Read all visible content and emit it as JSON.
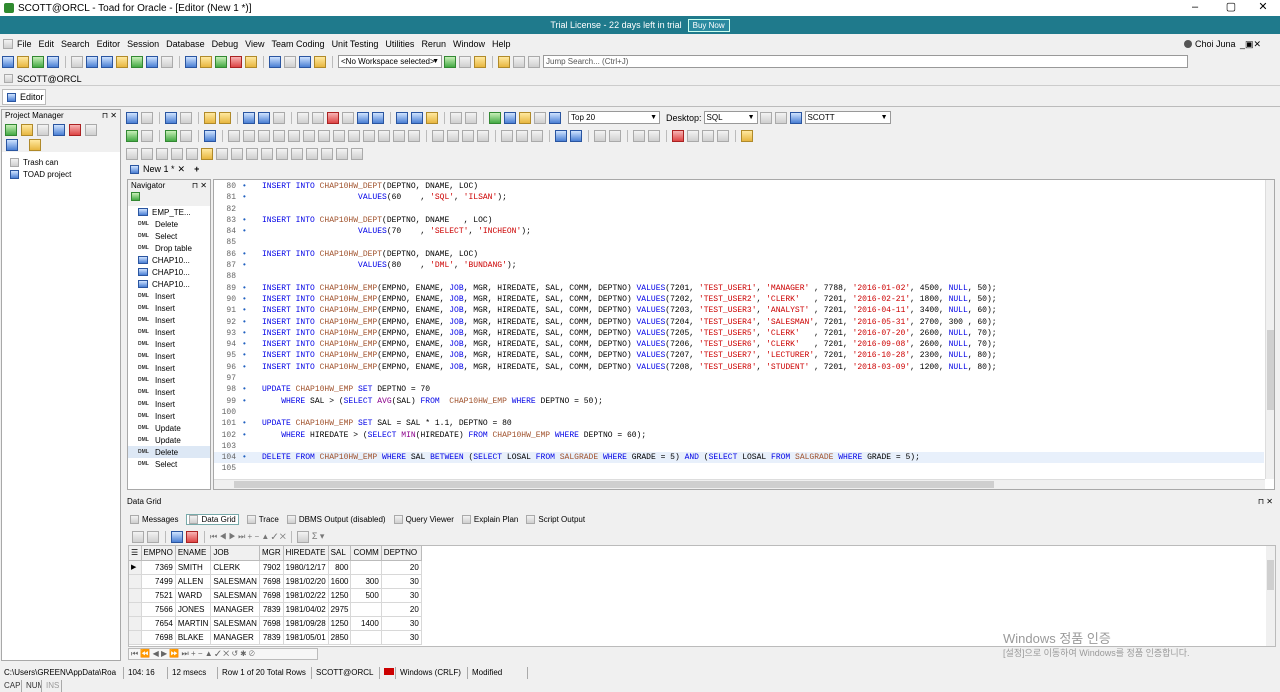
{
  "window": {
    "title": "SCOTT@ORCL - Toad for Oracle - [Editor (New 1 *)]"
  },
  "trial": {
    "text": "Trial License - 22 days left in trial",
    "buy": "Buy Now"
  },
  "menu": [
    "File",
    "Edit",
    "Search",
    "Editor",
    "Session",
    "Database",
    "Debug",
    "View",
    "Team Coding",
    "Unit Testing",
    "Utilities",
    "Rerun",
    "Window",
    "Help"
  ],
  "user": "Choi Juna",
  "workspace": "<No Workspace selected>",
  "jump_search": "Jump Search... (Ctrl+J)",
  "connection_tab": "SCOTT@ORCL",
  "editor_tab": "Editor",
  "project_manager": {
    "title": "Project Manager",
    "items": [
      "Trash can",
      "TOAD project"
    ]
  },
  "editor_toolbar": {
    "top_rows": "Top 20",
    "desktop_label": "Desktop:",
    "desktop_value": "SQL",
    "schema": "SCOTT"
  },
  "doc_tab": "New 1 *",
  "navigator": {
    "title": "Navigator",
    "items": [
      {
        "kind": "table",
        "label": "EMP_TE..."
      },
      {
        "kind": "dml",
        "label": "Delete"
      },
      {
        "kind": "dml",
        "label": "Select"
      },
      {
        "kind": "dml",
        "label": "Drop table"
      },
      {
        "kind": "table",
        "label": "CHAP10..."
      },
      {
        "kind": "table",
        "label": "CHAP10..."
      },
      {
        "kind": "table",
        "label": "CHAP10..."
      },
      {
        "kind": "dml",
        "label": "Insert"
      },
      {
        "kind": "dml",
        "label": "Insert"
      },
      {
        "kind": "dml",
        "label": "Insert"
      },
      {
        "kind": "dml",
        "label": "Insert"
      },
      {
        "kind": "dml",
        "label": "Insert"
      },
      {
        "kind": "dml",
        "label": "Insert"
      },
      {
        "kind": "dml",
        "label": "Insert"
      },
      {
        "kind": "dml",
        "label": "Insert"
      },
      {
        "kind": "dml",
        "label": "Insert"
      },
      {
        "kind": "dml",
        "label": "Insert"
      },
      {
        "kind": "dml",
        "label": "Insert"
      },
      {
        "kind": "dml",
        "label": "Update"
      },
      {
        "kind": "dml",
        "label": "Update"
      },
      {
        "kind": "dml",
        "label": "Delete"
      },
      {
        "kind": "dml",
        "label": "Select"
      }
    ]
  },
  "code_lines": [
    {
      "n": "80",
      "html": "<span class='kw'>INSERT INTO</span> <span class='tbl'>CHAP10HW_DEPT</span>(DEPTNO, DNAME, LOC)"
    },
    {
      "n": "81",
      "html": "                    <span class='kw'>VALUES</span>(60    , <span class='str'>'SQL'</span>, <span class='str'>'ILSAN'</span>);"
    },
    {
      "n": "82",
      "html": ""
    },
    {
      "n": "83",
      "html": "<span class='kw'>INSERT INTO</span> <span class='tbl'>CHAP10HW_DEPT</span>(DEPTNO, DNAME   , LOC)"
    },
    {
      "n": "84",
      "html": "                    <span class='kw'>VALUES</span>(70    , <span class='str'>'SELECT'</span>, <span class='str'>'INCHEON'</span>);"
    },
    {
      "n": "85",
      "html": ""
    },
    {
      "n": "86",
      "html": "<span class='kw'>INSERT INTO</span> <span class='tbl'>CHAP10HW_DEPT</span>(DEPTNO, DNAME, LOC)"
    },
    {
      "n": "87",
      "html": "                    <span class='kw'>VALUES</span>(80    , <span class='str'>'DML'</span>, <span class='str'>'BUNDANG'</span>);"
    },
    {
      "n": "88",
      "html": ""
    },
    {
      "n": "89",
      "html": "<span class='kw'>INSERT INTO</span> <span class='tbl'>CHAP10HW_EMP</span>(EMPNO, ENAME, <span class='kw'>JOB</span>, MGR, HIREDATE, SAL, COMM, DEPTNO) <span class='kw'>VALUES</span>(7201, <span class='str'>'TEST_USER1'</span>, <span class='str'>'MANAGER'</span> , 7788, <span class='str'>'2016-01-02'</span>, 4500, <span class='kw'>NULL</span>, 50);"
    },
    {
      "n": "90",
      "html": "<span class='kw'>INSERT INTO</span> <span class='tbl'>CHAP10HW_EMP</span>(EMPNO, ENAME, <span class='kw'>JOB</span>, MGR, HIREDATE, SAL, COMM, DEPTNO) <span class='kw'>VALUES</span>(7202, <span class='str'>'TEST_USER2'</span>, <span class='str'>'CLERK'</span>   , 7201, <span class='str'>'2016-02-21'</span>, 1800, <span class='kw'>NULL</span>, 50);"
    },
    {
      "n": "91",
      "html": "<span class='kw'>INSERT INTO</span> <span class='tbl'>CHAP10HW_EMP</span>(EMPNO, ENAME, <span class='kw'>JOB</span>, MGR, HIREDATE, SAL, COMM, DEPTNO) <span class='kw'>VALUES</span>(7203, <span class='str'>'TEST_USER3'</span>, <span class='str'>'ANALYST'</span> , 7201, <span class='str'>'2016-04-11'</span>, 3400, <span class='kw'>NULL</span>, 60);"
    },
    {
      "n": "92",
      "html": "<span class='kw'>INSERT INTO</span> <span class='tbl'>CHAP10HW_EMP</span>(EMPNO, ENAME, <span class='kw'>JOB</span>, MGR, HIREDATE, SAL, COMM, DEPTNO) <span class='kw'>VALUES</span>(7204, <span class='str'>'TEST_USER4'</span>, <span class='str'>'SALESMAN'</span>, 7201, <span class='str'>'2016-05-31'</span>, 2700, 300 , 60);"
    },
    {
      "n": "93",
      "html": "<span class='kw'>INSERT INTO</span> <span class='tbl'>CHAP10HW_EMP</span>(EMPNO, ENAME, <span class='kw'>JOB</span>, MGR, HIREDATE, SAL, COMM, DEPTNO) <span class='kw'>VALUES</span>(7205, <span class='str'>'TEST_USER5'</span>, <span class='str'>'CLERK'</span>   , 7201, <span class='str'>'2016-07-20'</span>, 2600, <span class='kw'>NULL</span>, 70);"
    },
    {
      "n": "94",
      "html": "<span class='kw'>INSERT INTO</span> <span class='tbl'>CHAP10HW_EMP</span>(EMPNO, ENAME, <span class='kw'>JOB</span>, MGR, HIREDATE, SAL, COMM, DEPTNO) <span class='kw'>VALUES</span>(7206, <span class='str'>'TEST_USER6'</span>, <span class='str'>'CLERK'</span>   , 7201, <span class='str'>'2016-09-08'</span>, 2600, <span class='kw'>NULL</span>, 70);"
    },
    {
      "n": "95",
      "html": "<span class='kw'>INSERT INTO</span> <span class='tbl'>CHAP10HW_EMP</span>(EMPNO, ENAME, <span class='kw'>JOB</span>, MGR, HIREDATE, SAL, COMM, DEPTNO) <span class='kw'>VALUES</span>(7207, <span class='str'>'TEST_USER7'</span>, <span class='str'>'LECTURER'</span>, 7201, <span class='str'>'2016-10-28'</span>, 2300, <span class='kw'>NULL</span>, 80);"
    },
    {
      "n": "96",
      "html": "<span class='kw'>INSERT INTO</span> <span class='tbl'>CHAP10HW_EMP</span>(EMPNO, ENAME, <span class='kw'>JOB</span>, MGR, HIREDATE, SAL, COMM, DEPTNO) <span class='kw'>VALUES</span>(7208, <span class='str'>'TEST_USER8'</span>, <span class='str'>'STUDENT'</span> , 7201, <span class='str'>'2018-03-09'</span>, 1200, <span class='kw'>NULL</span>, 80);"
    },
    {
      "n": "97",
      "html": ""
    },
    {
      "n": "98",
      "html": "<span class='kw'>UPDATE</span> <span class='tbl'>CHAP10HW_EMP</span> <span class='kw'>SET</span> DEPTNO = 70"
    },
    {
      "n": "99",
      "html": "    <span class='kw'>WHERE</span> SAL &gt; (<span class='kw'>SELECT</span> <span class='fn'>AVG</span>(SAL) <span class='kw'>FROM</span>  <span class='tbl'>CHAP10HW_EMP</span> <span class='kw'>WHERE</span> DEPTNO = 50);"
    },
    {
      "n": "100",
      "html": ""
    },
    {
      "n": "101",
      "html": "<span class='kw'>UPDATE</span> <span class='tbl'>CHAP10HW_EMP</span> <span class='kw'>SET</span> SAL = SAL * 1.1, DEPTNO = 80"
    },
    {
      "n": "102",
      "html": "    <span class='kw'>WHERE</span> HIREDATE &gt; (<span class='kw'>SELECT</span> <span class='fn'>MIN</span>(HIREDATE) <span class='kw'>FROM</span> <span class='tbl'>CHAP10HW_EMP</span> <span class='kw'>WHERE</span> DEPTNO = 60);"
    },
    {
      "n": "103",
      "html": ""
    },
    {
      "n": "104",
      "html": "<span class='kw'>DELETE FROM</span> <span class='tbl'>CHAP10HW_EMP</span> <span class='kw'>WHERE</span> SAL <span class='kw'>BETWEEN</span> (<span class='kw'>SELECT</span> LOSAL <span class='kw'>FROM</span> <span class='tbl'>SALGRADE</span> <span class='kw'>WHERE</span> GRADE = 5) <span class='kw'>AND</span> (<span class='kw'>SELECT</span> LOSAL <span class='kw'>FROM</span> <span class='tbl'>SALGRADE</span> <span class='kw'>WHERE</span> GRADE = 5);"
    },
    {
      "n": "105",
      "html": ""
    }
  ],
  "data_grid_panel": {
    "title": "Data Grid",
    "tabs": [
      "Messages",
      "Data Grid",
      "Trace",
      "DBMS Output (disabled)",
      "Query Viewer",
      "Explain Plan",
      "Script Output"
    ]
  },
  "grid": {
    "columns": [
      "EMPNO",
      "ENAME",
      "JOB",
      "MGR",
      "HIREDATE",
      "SAL",
      "COMM",
      "DEPTNO"
    ],
    "rows": [
      [
        "7369",
        "SMITH",
        "CLERK",
        "7902",
        "1980/12/17",
        "800",
        "",
        "20"
      ],
      [
        "7499",
        "ALLEN",
        "SALESMAN",
        "7698",
        "1981/02/20",
        "1600",
        "300",
        "30"
      ],
      [
        "7521",
        "WARD",
        "SALESMAN",
        "7698",
        "1981/02/22",
        "1250",
        "500",
        "30"
      ],
      [
        "7566",
        "JONES",
        "MANAGER",
        "7839",
        "1981/04/02",
        "2975",
        "",
        "20"
      ],
      [
        "7654",
        "MARTIN",
        "SALESMAN",
        "7698",
        "1981/09/28",
        "1250",
        "1400",
        "30"
      ],
      [
        "7698",
        "BLAKE",
        "MANAGER",
        "7839",
        "1981/05/01",
        "2850",
        "",
        "30"
      ]
    ]
  },
  "watermark": {
    "line1": "Windows 정품 인증",
    "line2": "[설정]으로 이동하여 Windows를 정품 인증합니다."
  },
  "status": {
    "path": "C:\\Users\\GREEN\\AppData\\Roa",
    "pos": "104:  16",
    "time": "12 msecs",
    "rows": "Row 1 of 20 Total Rows",
    "conn": "SCOTT@ORCL",
    "eol": "Windows (CRLF)",
    "modified": "Modified"
  },
  "status2": {
    "caps": "CAPS",
    "num": "NUM",
    "ins": "INS"
  }
}
